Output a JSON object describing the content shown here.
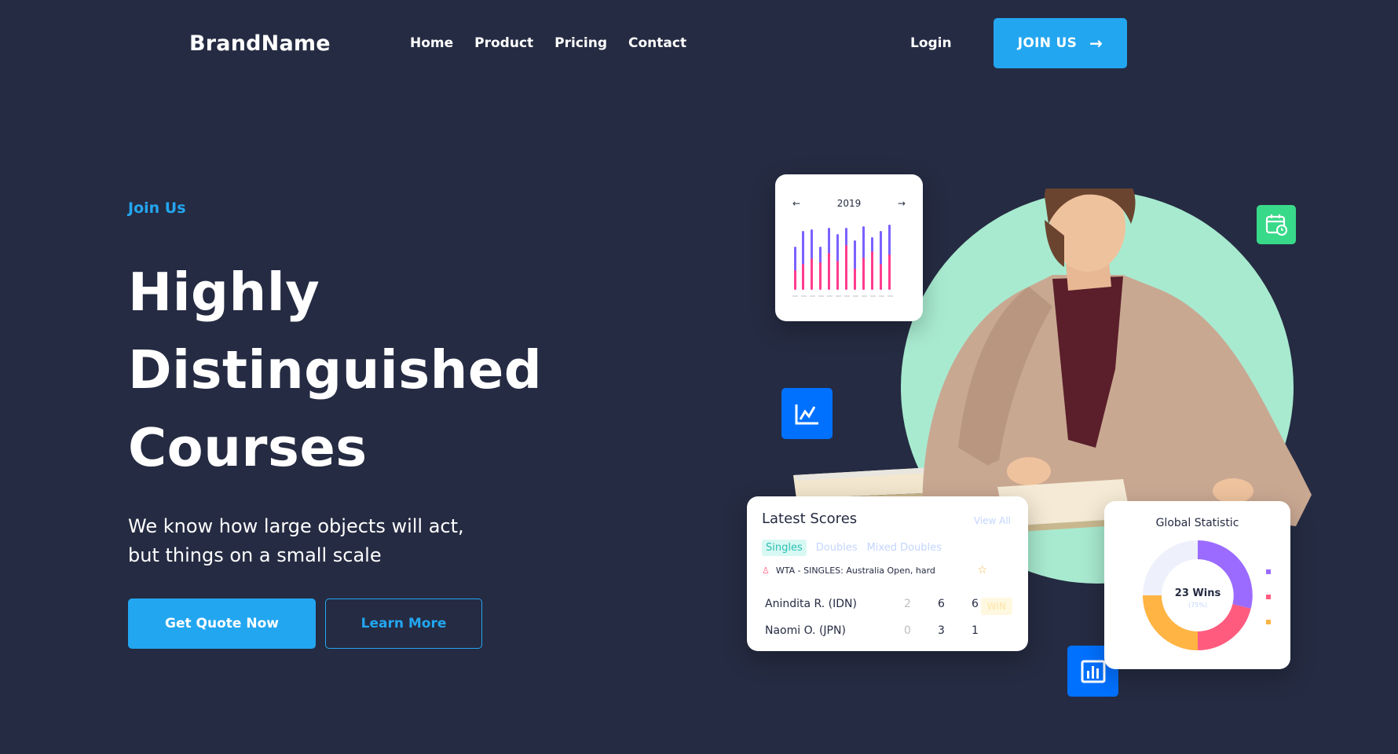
{
  "nav": {
    "brand": "BrandName",
    "links": [
      "Home",
      "Product",
      "Pricing",
      "Contact"
    ],
    "login": "Login",
    "join_label": "JOIN US"
  },
  "hero": {
    "eyebrow": "Join Us",
    "title_lines": [
      "Highly",
      "Distinguished",
      "Courses"
    ],
    "subtitle_lines": [
      "We know how large objects will act,",
      "but things on a small scale"
    ],
    "primary_button": "Get Quote Now",
    "secondary_button": "Learn More"
  },
  "year_card": {
    "year": "2019",
    "prev": "←",
    "next": "→"
  },
  "scores_card": {
    "title": "Latest Scores",
    "view_all": "View All",
    "tabs": [
      "Singles",
      "Doubles",
      "Mixed Doubles"
    ],
    "event": "WTA - SINGLES: Australia Open, hard",
    "rows": [
      {
        "name": "Anindita R. (IDN)",
        "s1": "2",
        "s2": "6",
        "s3": "6"
      },
      {
        "name": "Naomi O. (JPN)",
        "s1": "0",
        "s2": "3",
        "s3": "1"
      }
    ],
    "badge": "WIN"
  },
  "stat_card": {
    "title": "Global Statistic",
    "center_value": "23 Wins",
    "center_sub": "(75%)"
  },
  "colors": {
    "background": "#252b42",
    "accent": "#23a6f0",
    "mint": "#a8ead0",
    "icon_blue": "#0071ff",
    "icon_green": "#39d98a"
  },
  "icons": [
    "arrow-right-icon",
    "line-chart-icon",
    "bar-chart-icon",
    "calendar-clock-icon",
    "star-icon",
    "user-icon"
  ]
}
